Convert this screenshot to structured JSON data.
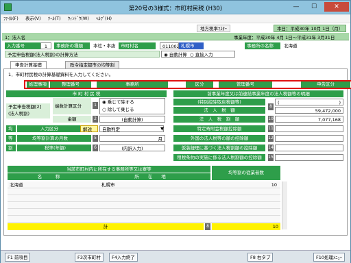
{
  "window": {
    "title": "第20号の3様式：市町村民税 (H30)",
    "min": "—",
    "max": "☐",
    "close": "✕"
  },
  "menu": [
    "ﾌｧｲﾙ(F)",
    "表示(V)",
    "ﾂｰﾙ(T)",
    "ｳｨﾝﾄﾞｳ(W)",
    "ﾍﾙﾌﾟ(H)"
  ],
  "toolbar": {
    "master": "地方税率ﾏｽﾀｰ",
    "date": "本日：平成30年 10月 1日（月）"
  },
  "header": {
    "corp_label": "1：法人名",
    "year_label": "事業年度：平成30年 4月 1日〜平成31年 3月31日"
  },
  "entry": {
    "no_label": "入力番号",
    "no_value": "1",
    "kind_label": "事務所の種類",
    "kind_value": "本社・本店",
    "city_label": "市町村名",
    "city_code": "011002",
    "city_name": "札幌市",
    "office_label": "事務所の名称",
    "office_value": "北海道",
    "calc_label": "予定申告税額(法人税割)の計算方法",
    "opt_auto": "自動計算",
    "opt_manual": "直接入力"
  },
  "tabs": [
    "申告計算基礎",
    "政令指定都市の均等割"
  ],
  "instruction": "1．市町村民税の計算基礎資料を入力してください。",
  "redbar": [
    "処理事項",
    "整理番号",
    "事務所",
    "区分",
    "管理番号",
    "申告区分"
  ],
  "left": {
    "head": "市 町 村 民 税",
    "pre_label": "予定申告税額[2]\n(法人税割)",
    "calc_type_label": "端数計算区分",
    "calc_opt1": "乗じて除する",
    "calc_opt2": "除して乗じる",
    "amount_label": "金額",
    "amount_value": "(自動計算)",
    "kin_label": "均",
    "input_kind_label": "入力区分",
    "badge": "解説",
    "input_kind_value": "自動判定",
    "months_label": "均等割計算の月数",
    "months_value": "月",
    "rate_label": "税率(年額)",
    "rate_value": "(内訳入力)",
    "rows_side": [
      "等",
      "割"
    ],
    "nums": [
      "4",
      "5",
      "6"
    ]
  },
  "right": {
    "head": "前事業年度又は前連結事業年度の法人税額等の明細",
    "special_label": "(特別控除取戻税額等)",
    "tax_label": "法　人　税　額",
    "tax_open": "(",
    "tax_close": ")",
    "tax_value": "59,472,000",
    "split_label": "法　人　税　割　額",
    "split_value": "7,077,168",
    "rows": [
      "特定寄附金税額控除額",
      "外国の法人税等の額の控除額",
      "仮装経理に基づく法人税割額の控除額",
      "租税条約の実施に係る法人税割額の控除額"
    ],
    "nums": [
      "8",
      "9",
      "10",
      "11",
      "12",
      "13",
      "14",
      "15"
    ]
  },
  "grid": {
    "head": "当該市町村内に所在する事務所等又は寮等",
    "col_name": "名　　　称",
    "col_addr": "所　　在　　地",
    "col_count": "均等割の従業者数",
    "rows": [
      {
        "name": "北海道",
        "addr": "札幌市",
        "count": "10"
      }
    ],
    "total_label": "計",
    "total_num": "8",
    "total_value": "10"
  },
  "fkeys": [
    "F1 前項目",
    "F3次市町村",
    "F4入力終了",
    "F8 右タブ",
    "F10処理ﾒﾆｭｰ"
  ]
}
